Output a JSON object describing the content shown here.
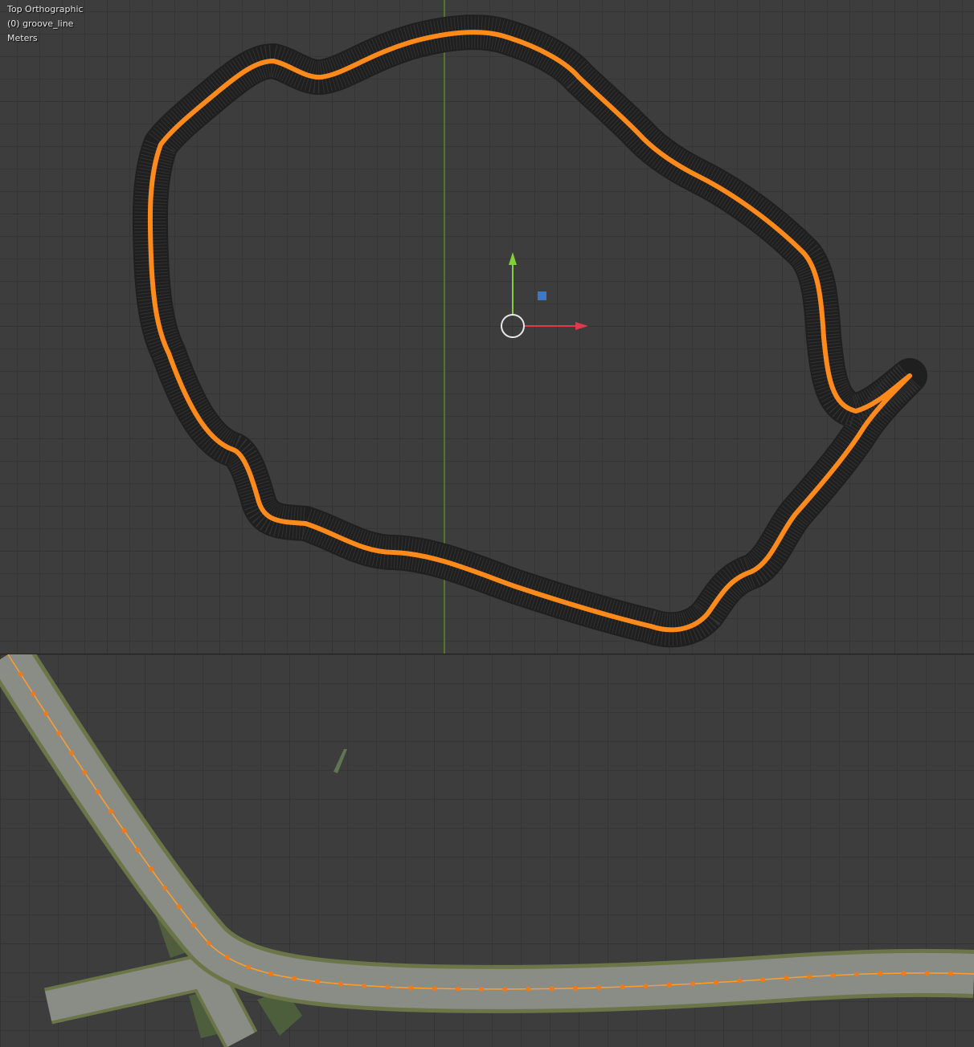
{
  "viewport_top": {
    "view_name": "Top Orthographic",
    "object_label": "(0) groove_line",
    "units": "Meters",
    "colors": {
      "background": "#3d3d3d",
      "track_mesh": "#1e1e1e",
      "curve": "#ff8a1c",
      "y_axis": "#6a9a2a",
      "gizmo_y": "#7fd13b",
      "gizmo_x": "#e0384f",
      "gizmo_z": "#3d78c8"
    },
    "icons": [
      "y-axis-arrow-icon",
      "x-axis-arrow-icon",
      "z-axis-square-icon",
      "3d-cursor-icon"
    ]
  },
  "viewport_bottom": {
    "colors": {
      "road": "#8a8c86",
      "road_edge": "#6b7548",
      "grass": "#4c5e3c",
      "curve": "#ff8a1c",
      "curve_point": "#f07a18"
    }
  }
}
